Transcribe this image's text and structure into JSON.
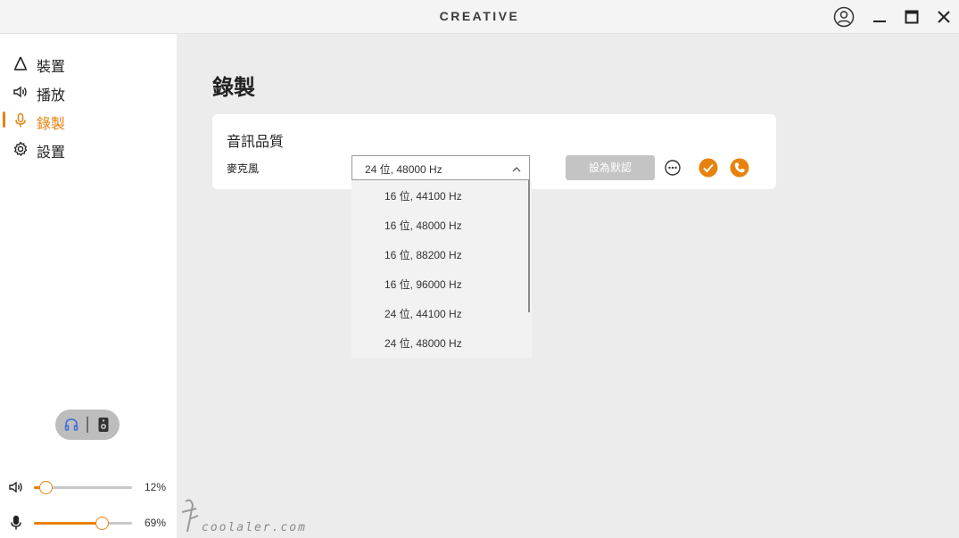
{
  "app": {
    "brand": "CREATIVE"
  },
  "window": {
    "icons": [
      "account-icon",
      "minimize-icon",
      "maximize-icon",
      "close-icon"
    ]
  },
  "sidebar": {
    "items": [
      {
        "label": "裝置",
        "icon": "device-icon",
        "active": false
      },
      {
        "label": "播放",
        "icon": "speaker-icon",
        "active": false
      },
      {
        "label": "錄製",
        "icon": "microphone-icon",
        "active": true
      },
      {
        "label": "設置",
        "icon": "gear-icon",
        "active": false
      }
    ],
    "output_toggle": {
      "options": [
        "headphones-icon",
        "speaker-icon"
      ],
      "selected": "headphones-icon"
    },
    "volume": {
      "label": "12%",
      "value": 12
    },
    "mic_volume": {
      "label": "69%",
      "value": 69
    }
  },
  "main": {
    "title": "錄製",
    "card": {
      "title": "音訊品質",
      "mic_label": "麥克風",
      "selected": "24 位, 48000 Hz",
      "default_button": "設為默認",
      "options": [
        "16 位, 44100 Hz",
        "16 位, 48000 Hz",
        "16 位, 88200 Hz",
        "16 位, 96000 Hz",
        "24 位, 44100 Hz",
        "24 位, 48000 Hz"
      ]
    }
  },
  "watermark": {
    "text": "coolaler.com"
  },
  "colors": {
    "accent": "#e8820e",
    "sidebar_bg": "#ffffff",
    "main_bg": "#ececec"
  }
}
